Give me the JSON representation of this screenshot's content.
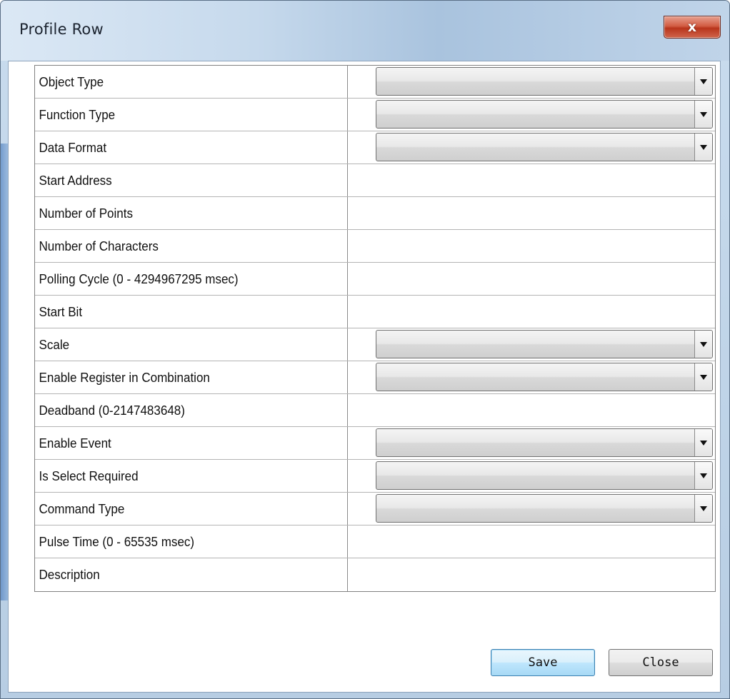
{
  "window": {
    "title": "Profile Row",
    "close_glyph": "x"
  },
  "rows": [
    {
      "label": "Object Type",
      "control": "dropdown",
      "value": ""
    },
    {
      "label": "Function Type",
      "control": "dropdown",
      "value": ""
    },
    {
      "label": "Data Format",
      "control": "dropdown",
      "value": ""
    },
    {
      "label": "Start Address",
      "control": "text",
      "value": ""
    },
    {
      "label": "Number of Points",
      "control": "text",
      "value": ""
    },
    {
      "label": "Number of Characters",
      "control": "text",
      "value": ""
    },
    {
      "label": "Polling  Cycle (0 - 4294967295 msec)",
      "control": "text",
      "value": ""
    },
    {
      "label": "Start Bit",
      "control": "text",
      "value": ""
    },
    {
      "label": "Scale",
      "control": "dropdown",
      "value": ""
    },
    {
      "label": "Enable Register in Combination",
      "control": "dropdown",
      "value": ""
    },
    {
      "label": "Deadband (0-2147483648)",
      "control": "text",
      "value": ""
    },
    {
      "label": "Enable Event",
      "control": "dropdown",
      "value": ""
    },
    {
      "label": "Is Select Required",
      "control": "dropdown",
      "value": ""
    },
    {
      "label": "Command Type",
      "control": "dropdown",
      "value": ""
    },
    {
      "label": "Pulse Time (0 - 65535 msec)",
      "control": "text",
      "value": ""
    },
    {
      "label": "Description",
      "control": "text",
      "value": ""
    }
  ],
  "buttons": {
    "save_label": "Save",
    "close_label": "Close"
  },
  "icons": {
    "dropdown": "chevron-down-icon",
    "close": "close-icon"
  }
}
